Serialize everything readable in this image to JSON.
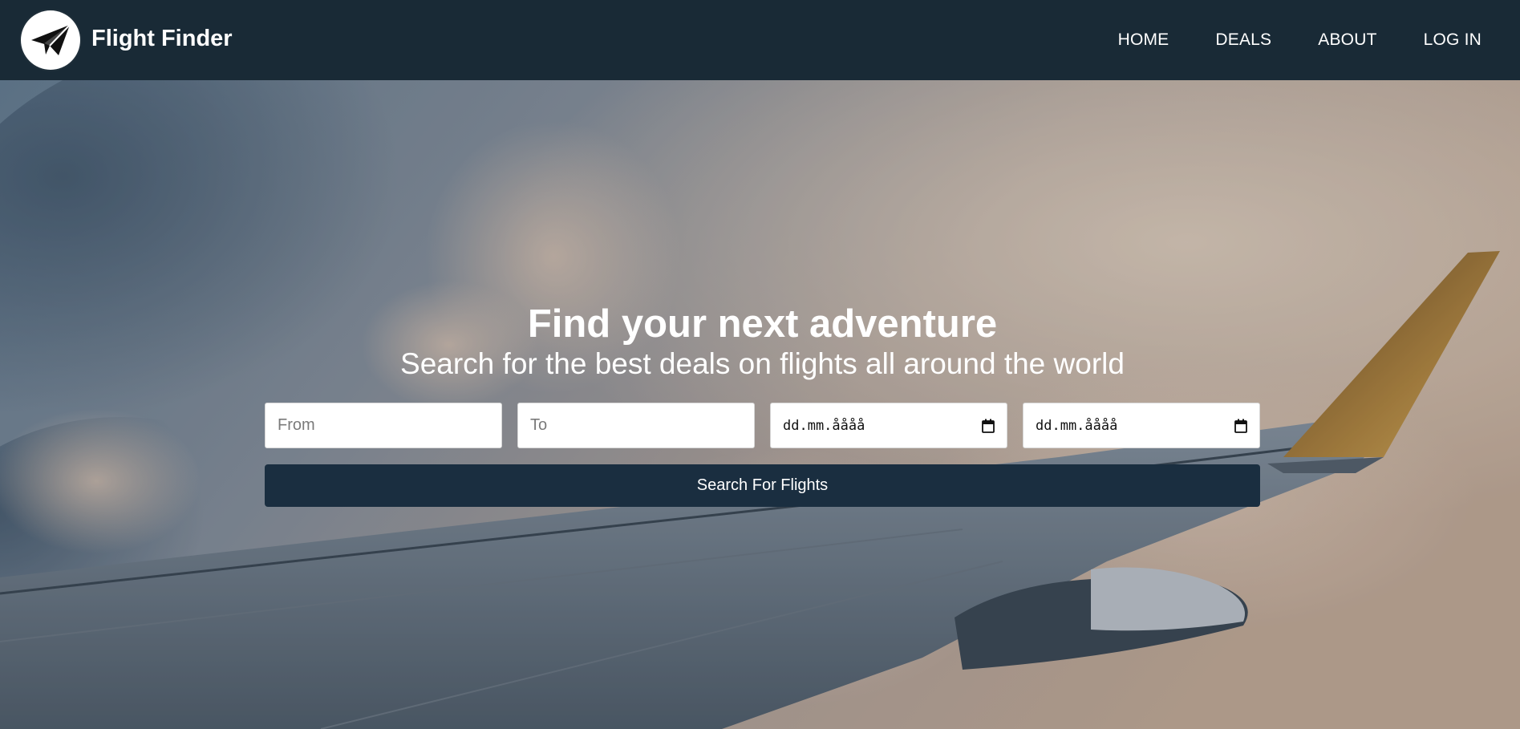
{
  "header": {
    "brand": "Flight Finder",
    "logo_icon": "paper-plane-icon",
    "nav": [
      {
        "label": "HOME"
      },
      {
        "label": "DEALS"
      },
      {
        "label": "ABOUT"
      },
      {
        "label": "LOG IN"
      }
    ]
  },
  "hero": {
    "title": "Find your next adventure",
    "subtitle": "Search for the best deals on flights all around the world",
    "form": {
      "from_placeholder": "From",
      "to_placeholder": "To",
      "depart_date": "dd.mm.åååå",
      "return_date": "dd.mm.åååå",
      "calendar_icon": "calendar-icon",
      "search_label": "Search For Flights"
    }
  },
  "colors": {
    "header_bg": "#192a36",
    "button_bg": "#1a2e40",
    "text_light": "#ffffff"
  }
}
